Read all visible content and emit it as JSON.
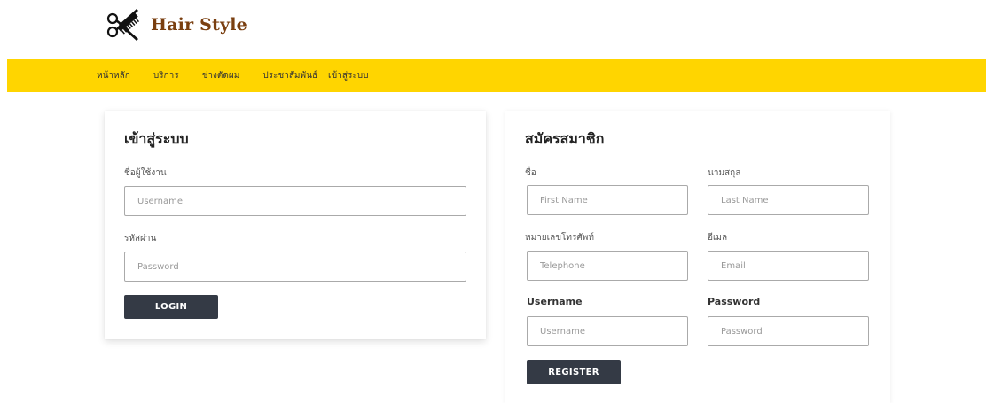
{
  "brand": {
    "name": "Hair Style",
    "logo_icon": "scissors-comb-icon",
    "color": "#7a3f10"
  },
  "nav": {
    "background": "#ffd500",
    "items": [
      "หน้าหลัก",
      "บริการ",
      "ช่างตัดผม",
      "ประชาสัมพันธ์",
      "เข้าสู่ระบบ"
    ]
  },
  "login": {
    "title": "เข้าสู่ระบบ",
    "username_label": "ชื่อผู้ใช้งาน",
    "username_placeholder": "Username",
    "username_value": "",
    "password_label": "รหัสผ่าน",
    "password_placeholder": "Password",
    "password_value": "",
    "button": "LOGIN"
  },
  "register": {
    "title": "สมัครสมาชิก",
    "first_name_label": "ชื่อ",
    "first_name_placeholder": "First Name",
    "last_name_label": "นามสกุล",
    "last_name_placeholder": "Last Name",
    "telephone_label": "หมายเลขโทรศัพท์",
    "telephone_placeholder": "Telephone",
    "email_label": "อีเมล",
    "email_placeholder": "Email",
    "username_label": "Username",
    "username_placeholder": "Username",
    "password_label": "Password",
    "password_placeholder": "Password",
    "button": "REGISTER",
    "button_color": "#343a45"
  }
}
